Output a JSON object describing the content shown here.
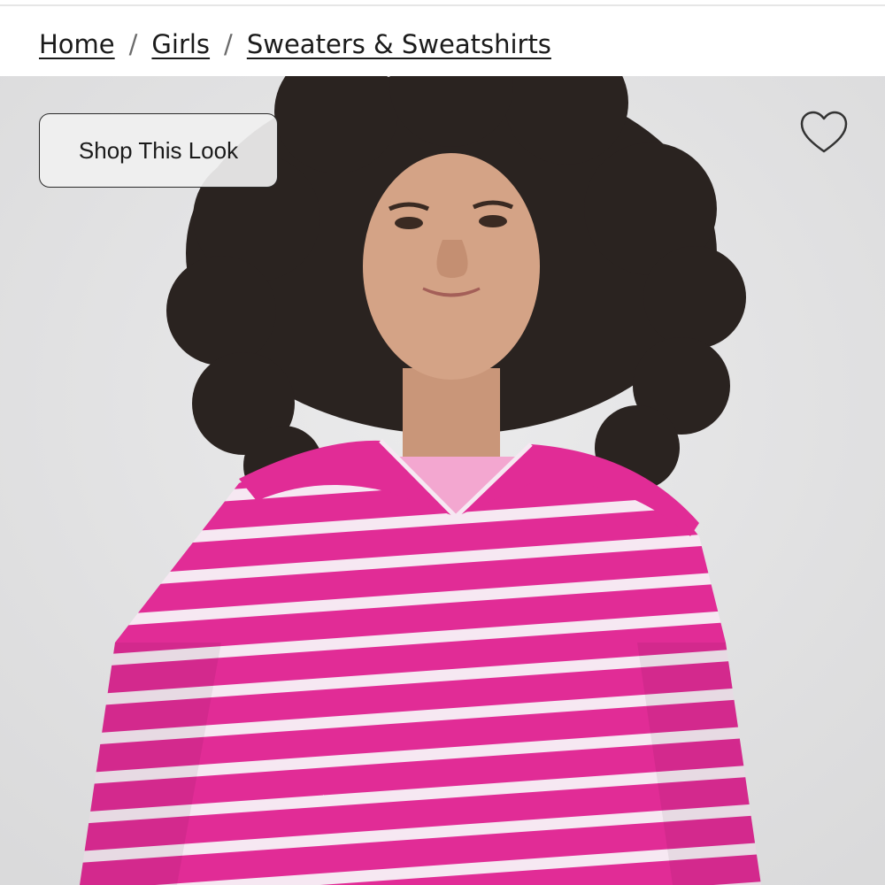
{
  "breadcrumb": {
    "items": [
      "Home",
      "Girls",
      "Sweaters & Sweatshirts"
    ],
    "separator": "/"
  },
  "hero": {
    "shop_button_label": "Shop This Look",
    "favorite_icon": "heart-outline-icon",
    "sweater_color": "#e12c96",
    "stripe_color": "#f6e8f2",
    "background_color": "#e3e3e4"
  }
}
